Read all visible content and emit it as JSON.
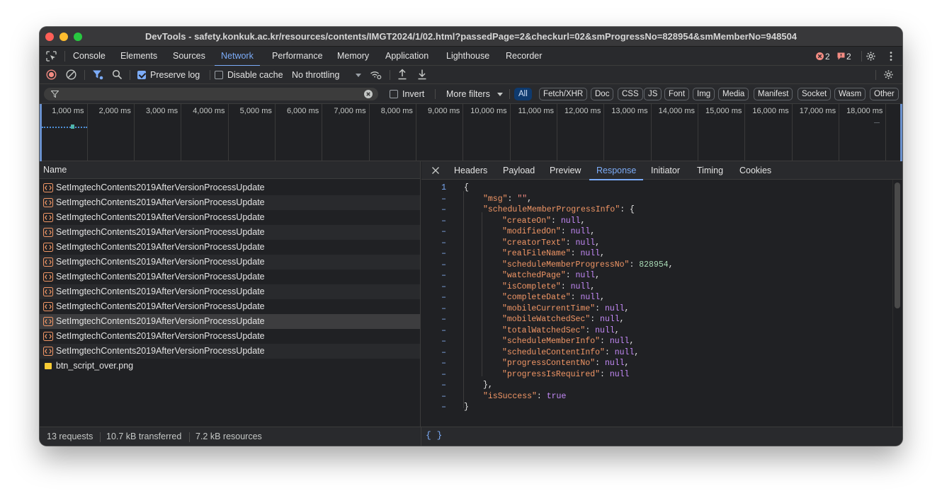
{
  "window": {
    "title": "DevTools - safety.konkuk.ac.kr/resources/contents/IMGT2024/1/02.html?passedPage=2&checkurl=02&smProgressNo=828954&smMemberNo=948504"
  },
  "main_tabs": [
    "Console",
    "Elements",
    "Sources",
    "Network",
    "Performance",
    "Memory",
    "Application",
    "Lighthouse",
    "Recorder"
  ],
  "active_main_tab": "Network",
  "issues": {
    "errors": "2",
    "warnings": "2"
  },
  "toolbar": {
    "preserve_log": "Preserve log",
    "disable_cache": "Disable cache",
    "throttling": "No throttling"
  },
  "filter": {
    "invert": "Invert",
    "more_filters": "More filters"
  },
  "type_filters": [
    "All",
    "Fetch/XHR",
    "Doc",
    "CSS",
    "JS",
    "Font",
    "Img",
    "Media",
    "Manifest",
    "Socket",
    "Wasm",
    "Other"
  ],
  "timeline_ticks": [
    "1,000 ms",
    "2,000 ms",
    "3,000 ms",
    "4,000 ms",
    "5,000 ms",
    "6,000 ms",
    "7,000 ms",
    "8,000 ms",
    "9,000 ms",
    "10,000 ms",
    "11,000 ms",
    "12,000 ms",
    "13,000 ms",
    "14,000 ms",
    "15,000 ms",
    "16,000 ms",
    "17,000 ms",
    "18,000 ms"
  ],
  "request_list": {
    "header": "Name",
    "rows": [
      "SetImgtechContents2019AfterVersionProcessUpdate",
      "SetImgtechContents2019AfterVersionProcessUpdate",
      "SetImgtechContents2019AfterVersionProcessUpdate",
      "SetImgtechContents2019AfterVersionProcessUpdate",
      "SetImgtechContents2019AfterVersionProcessUpdate",
      "SetImgtechContents2019AfterVersionProcessUpdate",
      "SetImgtechContents2019AfterVersionProcessUpdate",
      "SetImgtechContents2019AfterVersionProcessUpdate",
      "SetImgtechContents2019AfterVersionProcessUpdate",
      "SetImgtechContents2019AfterVersionProcessUpdate",
      "SetImgtechContents2019AfterVersionProcessUpdate",
      "SetImgtechContents2019AfterVersionProcessUpdate",
      "btn_script_over.png"
    ],
    "selected_index": 9
  },
  "detail_tabs": [
    "Headers",
    "Payload",
    "Preview",
    "Response",
    "Initiator",
    "Timing",
    "Cookies"
  ],
  "active_detail_tab": "Response",
  "response": {
    "first_line_number": "1",
    "lines": [
      {
        "indent": 0,
        "text": "{"
      },
      {
        "indent": 1,
        "key": "\"msg\"",
        "value": "\"\"",
        "type": "string",
        "comma": true
      },
      {
        "indent": 1,
        "key": "\"scheduleMemberProgressInfo\"",
        "value": "{",
        "type": "brace"
      },
      {
        "indent": 2,
        "key": "\"createOn\"",
        "value": "null",
        "type": "null",
        "comma": true
      },
      {
        "indent": 2,
        "key": "\"modifiedOn\"",
        "value": "null",
        "type": "null",
        "comma": true
      },
      {
        "indent": 2,
        "key": "\"creatorText\"",
        "value": "null",
        "type": "null",
        "comma": true
      },
      {
        "indent": 2,
        "key": "\"realFileName\"",
        "value": "null",
        "type": "null",
        "comma": true
      },
      {
        "indent": 2,
        "key": "\"scheduleMemberProgressNo\"",
        "value": "828954",
        "type": "number",
        "comma": true
      },
      {
        "indent": 2,
        "key": "\"watchedPage\"",
        "value": "null",
        "type": "null",
        "comma": true
      },
      {
        "indent": 2,
        "key": "\"isComplete\"",
        "value": "null",
        "type": "null",
        "comma": true
      },
      {
        "indent": 2,
        "key": "\"completeDate\"",
        "value": "null",
        "type": "null",
        "comma": true
      },
      {
        "indent": 2,
        "key": "\"mobileCurrentTime\"",
        "value": "null",
        "type": "null",
        "comma": true
      },
      {
        "indent": 2,
        "key": "\"mobileWatchedSec\"",
        "value": "null",
        "type": "null",
        "comma": true
      },
      {
        "indent": 2,
        "key": "\"totalWatchedSec\"",
        "value": "null",
        "type": "null",
        "comma": true
      },
      {
        "indent": 2,
        "key": "\"scheduleMemberInfo\"",
        "value": "null",
        "type": "null",
        "comma": true
      },
      {
        "indent": 2,
        "key": "\"scheduleContentInfo\"",
        "value": "null",
        "type": "null",
        "comma": true
      },
      {
        "indent": 2,
        "key": "\"progressContentNo\"",
        "value": "null",
        "type": "null",
        "comma": true
      },
      {
        "indent": 2,
        "key": "\"progressIsRequired\"",
        "value": "null",
        "type": "null",
        "comma": false
      },
      {
        "indent": 1,
        "text": "},"
      },
      {
        "indent": 1,
        "key": "\"isSuccess\"",
        "value": "true",
        "type": "bool",
        "comma": false
      },
      {
        "indent": 0,
        "text": "}"
      }
    ]
  },
  "status": {
    "requests": "13 requests",
    "transferred": "10.7 kB transferred",
    "resources": "7.2 kB resources",
    "pretty_print": "{ }"
  },
  "colors": {
    "accent": "#7cacf8",
    "error": "#f28b82",
    "warning": "#f28b82",
    "key": "#f29766",
    "null": "#c58af9",
    "number": "#a8dab5"
  }
}
